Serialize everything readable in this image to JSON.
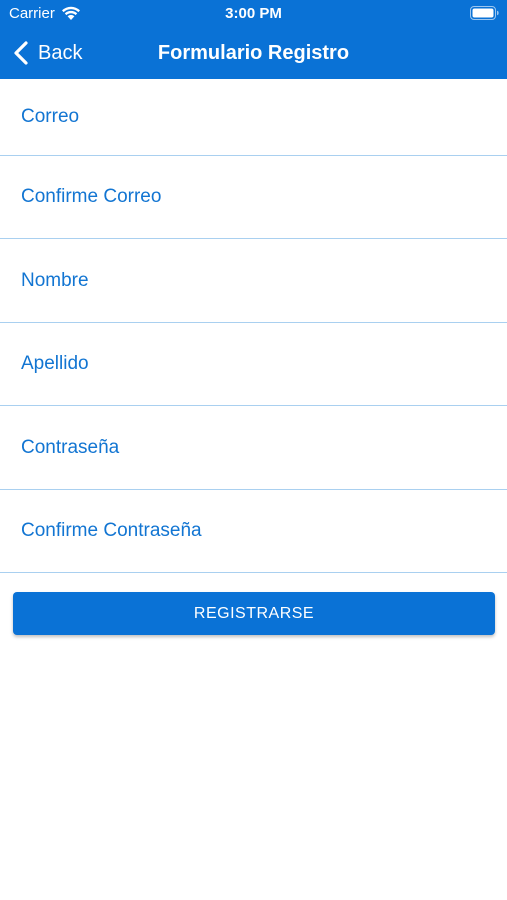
{
  "status_bar": {
    "carrier": "Carrier",
    "time": "3:00 PM",
    "wifi_icon": "wifi-icon",
    "battery_icon": "battery-icon"
  },
  "nav": {
    "back_label": "Back",
    "back_icon": "chevron-left-icon",
    "title": "Formulario Registro"
  },
  "form": {
    "fields": [
      {
        "placeholder": "Correo",
        "value": ""
      },
      {
        "placeholder": "Confirme Correo",
        "value": ""
      },
      {
        "placeholder": "Nombre",
        "value": ""
      },
      {
        "placeholder": "Apellido",
        "value": ""
      },
      {
        "placeholder": "Contraseña",
        "value": ""
      },
      {
        "placeholder": "Confirme Contraseña",
        "value": ""
      }
    ],
    "submit_label": "REGISTRARSE"
  },
  "colors": {
    "primary": "#0a72d6",
    "field_text": "#1275d2",
    "divider": "#a9d0f0",
    "background": "#ffffff"
  }
}
